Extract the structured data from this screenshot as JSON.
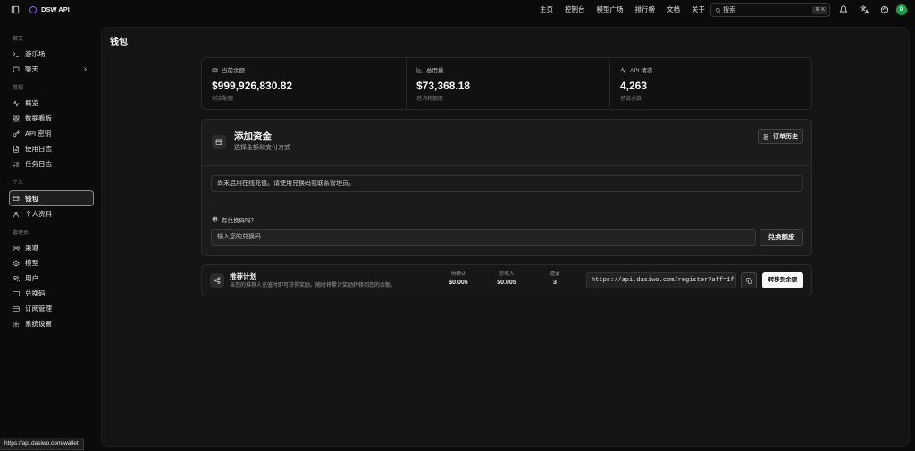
{
  "app": {
    "title": "DSW API"
  },
  "topnav": {
    "links": [
      {
        "label": "主页"
      },
      {
        "label": "控制台"
      },
      {
        "label": "模型广场"
      },
      {
        "label": "排行榜"
      },
      {
        "label": "文档"
      },
      {
        "label": "关于"
      }
    ],
    "search": {
      "placeholder": "搜索",
      "shortcut": "⌘ K"
    },
    "icons": [
      "bell-icon",
      "translate-icon",
      "palette-icon"
    ]
  },
  "user": {
    "avatar_initial": "D"
  },
  "sidebar": {
    "sections": [
      {
        "label": "聊天",
        "items": [
          {
            "label": "游乐场",
            "icon": "terminal-icon"
          },
          {
            "label": "聊天",
            "icon": "message-icon",
            "expandable": true
          }
        ]
      },
      {
        "label": "常规",
        "items": [
          {
            "label": "概览",
            "icon": "activity-icon"
          },
          {
            "label": "数据看板",
            "icon": "dashboard-icon"
          },
          {
            "label": "API 密钥",
            "icon": "key-icon"
          },
          {
            "label": "使用日志",
            "icon": "file-text-icon"
          },
          {
            "label": "任务日志",
            "icon": "list-checks-icon"
          }
        ]
      },
      {
        "label": "个人",
        "items": [
          {
            "label": "钱包",
            "icon": "wallet-icon",
            "active": true
          },
          {
            "label": "个人资料",
            "icon": "user-icon"
          }
        ]
      },
      {
        "label": "管理员",
        "items": [
          {
            "label": "渠道",
            "icon": "radio-icon"
          },
          {
            "label": "模型",
            "icon": "box-icon"
          },
          {
            "label": "用户",
            "icon": "users-icon"
          },
          {
            "label": "兑换码",
            "icon": "ticket-icon"
          },
          {
            "label": "订阅管理",
            "icon": "credit-card-icon"
          },
          {
            "label": "系统设置",
            "icon": "gear-icon"
          }
        ]
      }
    ]
  },
  "page": {
    "title": "钱包"
  },
  "stats": [
    {
      "icon": "wallet-icon",
      "label": "当前余额",
      "value": "$999,926,830.82",
      "sub": "剩余配额"
    },
    {
      "icon": "bar-chart-icon",
      "label": "总用量",
      "value": "$73,368.18",
      "sub": "总消耗额度"
    },
    {
      "icon": "activity-icon",
      "label": "API 请求",
      "value": "4,263",
      "sub": "总请求数"
    }
  ],
  "add_funds": {
    "title": "添加资金",
    "subtitle": "选择金额和支付方式",
    "order_history_label": "订单历史",
    "notice": "尚未启用在线充值。请使用兑换码或联系管理员。",
    "redeem_prompt": "有兑换码吗？",
    "redeem_placeholder": "输入您的兑换码",
    "redeem_button": "兑换额度"
  },
  "referral": {
    "title": "推荐计划",
    "description": "当您的推荐人充值时即可获得奖励。随时将累计奖励转移到您的余额。",
    "stats": [
      {
        "label": "待确认",
        "value": "$0.005"
      },
      {
        "label": "总收入",
        "value": "$0.005"
      },
      {
        "label": "邀请",
        "value": "3"
      }
    ],
    "link": "https://api.dasiwo.com/register?aff=1f",
    "transfer_button": "转移到余额"
  },
  "status_bar": {
    "url": "https://api.dasiwo.com/wallet"
  },
  "colors": {
    "page_bg": "#0b0b0b",
    "panel_bg": "#141414",
    "logo": "#8b5cf6",
    "avatar": "#16a34a",
    "primary_button": "#fafafa"
  }
}
